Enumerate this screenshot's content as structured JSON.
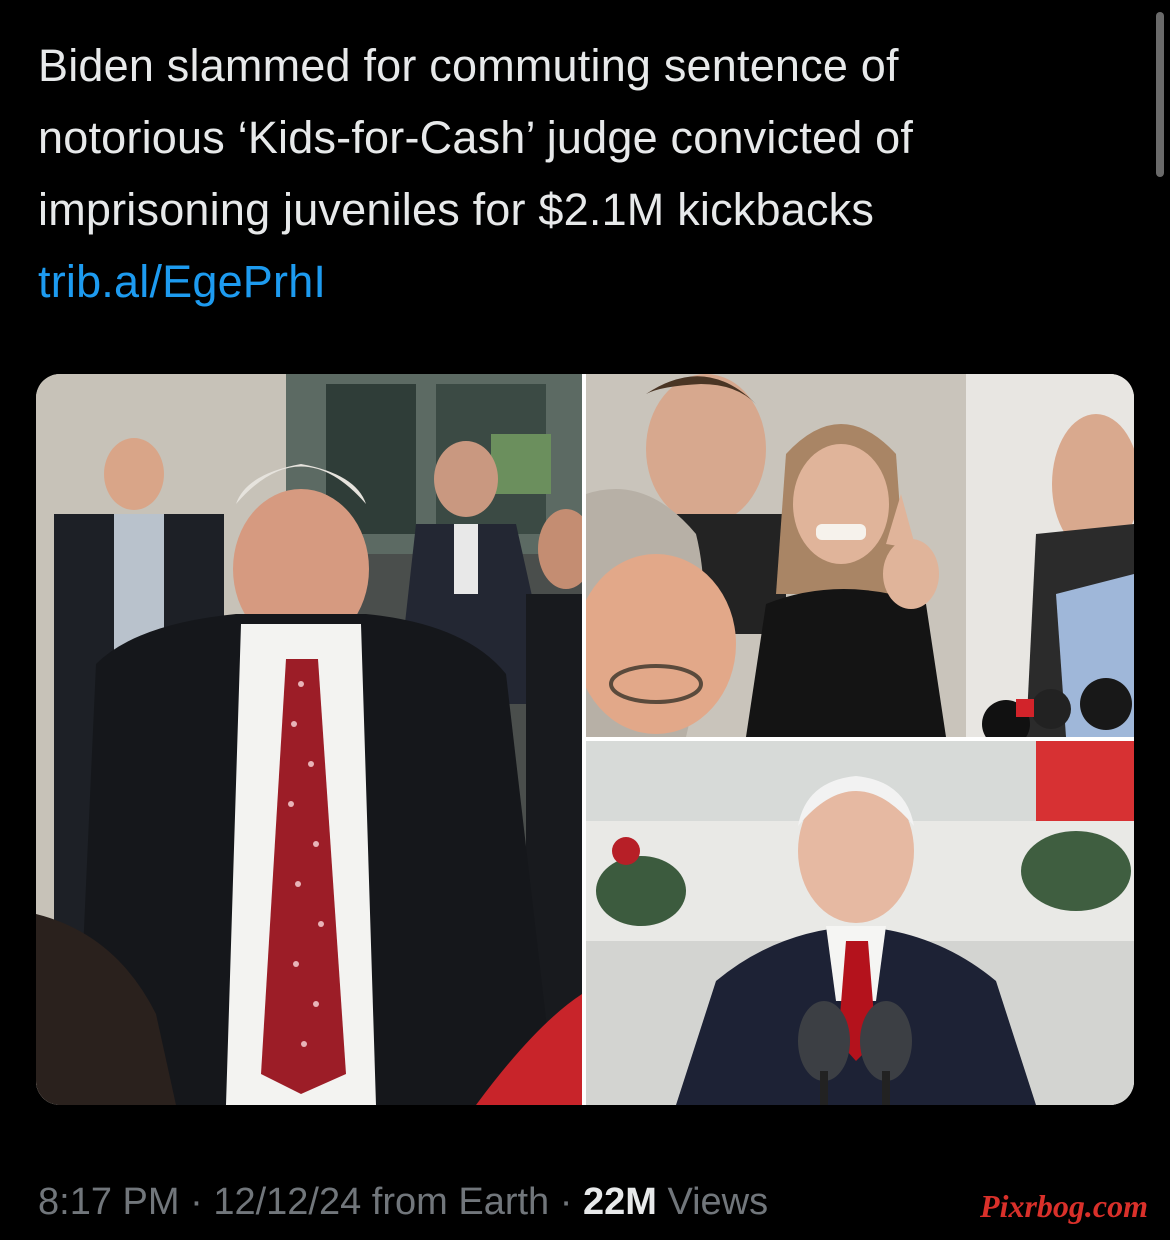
{
  "tweet": {
    "lines": [
      "Biden slammed for commuting sentence of",
      "notorious ‘Kids-for-Cash’ judge convicted of",
      "imprisoning juveniles for $2.1M kickbacks"
    ],
    "link": "trib.al/EgePrhI"
  },
  "media": {
    "photos": [
      {
        "name": "photo-judge-leaving-courthouse"
      },
      {
        "name": "photo-angry-woman-pointing"
      },
      {
        "name": "photo-biden-at-podium"
      }
    ]
  },
  "meta": {
    "time": "8:17 PM",
    "sep1": " · ",
    "date": "12/12/24",
    "from": " from Earth",
    "sep2": " · ",
    "views_count": "22M",
    "views_label": " Views"
  },
  "watermark": {
    "text": "Pixrbog.com"
  },
  "colors": {
    "background": "#000000",
    "text": "#e7e9ea",
    "link": "#1d9bf0",
    "muted": "#71767b",
    "watermark": "#d9302a"
  }
}
